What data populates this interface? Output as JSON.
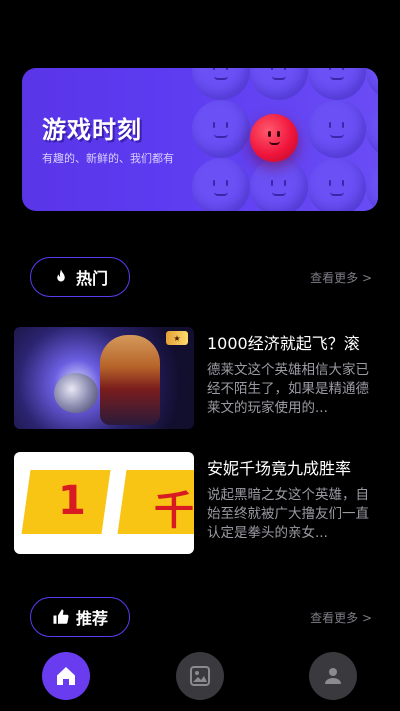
{
  "banner": {
    "title": "游戏时刻",
    "subtitle": "有趣的、新鲜的、我们都有"
  },
  "sections": {
    "hot": {
      "label": "热门",
      "see_more": "查看更多 >"
    },
    "recommend": {
      "label": "推荐",
      "see_more": "查看更多 >"
    }
  },
  "articles": [
    {
      "title": "1000经济就起飞？滚",
      "description": "德莱文这个英雄相信大家已经不陌生了，如果是精通德莱文的玩家使用的..."
    },
    {
      "title": "安妮千场竟九成胜率",
      "description": "说起黑暗之女这个英雄，自始至终就被广大撸友们一直认定是拳头的亲女..."
    }
  ],
  "thumb2_glyphs": [
    "1",
    "千"
  ],
  "nav": {
    "items": [
      "home",
      "gallery",
      "profile"
    ],
    "active": "home"
  },
  "colors": {
    "accent": "#6a3cf0",
    "banner": "#5a35e8",
    "background": "#000000"
  }
}
